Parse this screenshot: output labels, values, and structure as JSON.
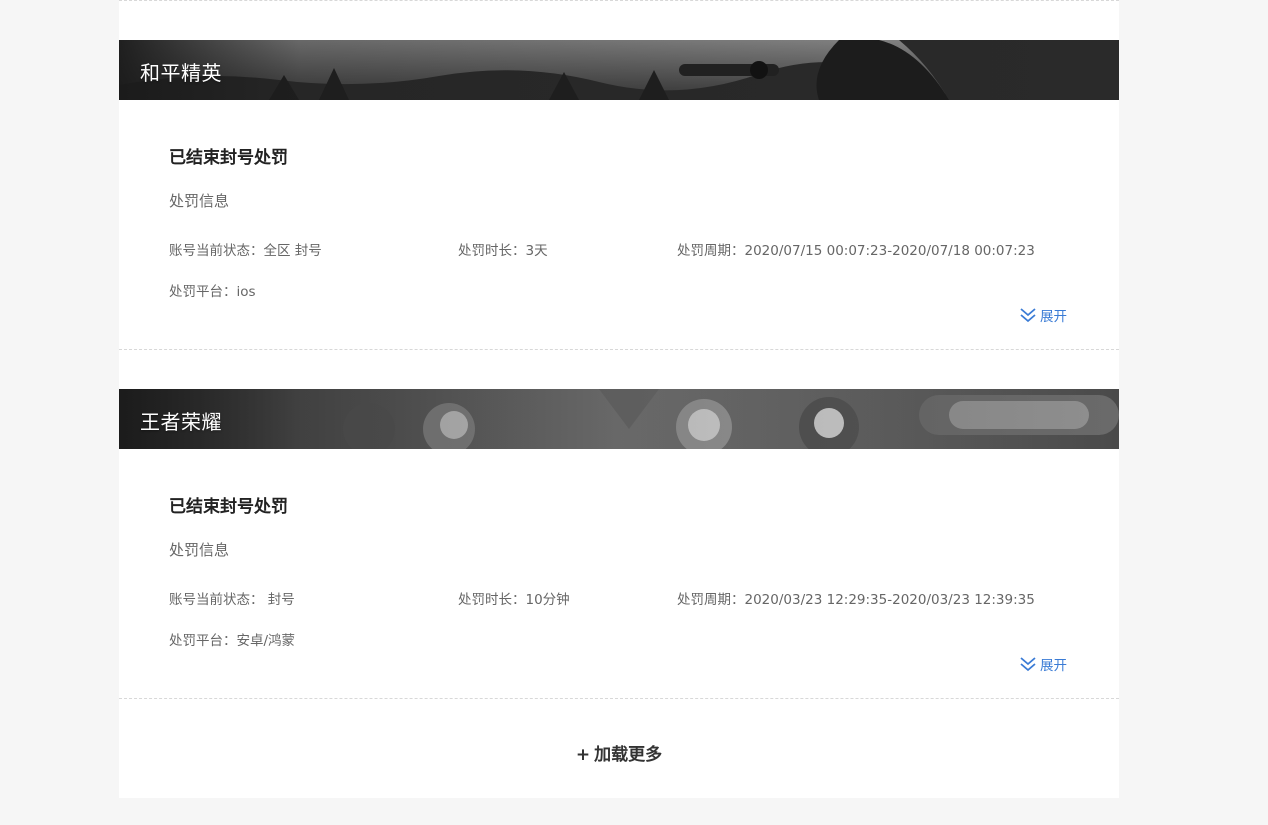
{
  "records": [
    {
      "game": "和平精英",
      "status_title": "已结束封号处罚",
      "section_label": "处罚信息",
      "fields": {
        "status_key": "账号当前状态：",
        "status_value": "全区 封号",
        "duration_key": "处罚时长：",
        "duration_value": "3天",
        "period_key": "处罚周期：",
        "period_value": "2020/07/15 00:07:23-2020/07/18 00:07:23",
        "platform_key": "处罚平台：",
        "platform_value": "ios"
      },
      "expand_label": "展开"
    },
    {
      "game": "王者荣耀",
      "status_title": "已结束封号处罚",
      "section_label": "处罚信息",
      "fields": {
        "status_key": "账号当前状态：",
        "status_value": " 封号",
        "duration_key": "处罚时长：",
        "duration_value": "10分钟",
        "period_key": "处罚周期：",
        "period_value": "2020/03/23 12:29:35-2020/03/23 12:39:35",
        "platform_key": "处罚平台：",
        "platform_value": "安卓/鸿蒙"
      },
      "expand_label": "展开"
    }
  ],
  "load_more": {
    "icon": "+",
    "label": "加载更多"
  },
  "icons": {
    "expand": "double-chevron-down-icon"
  },
  "colors": {
    "accent": "#3a7bd5",
    "page_bg": "#f6f6f6",
    "card_bg": "#ffffff"
  }
}
